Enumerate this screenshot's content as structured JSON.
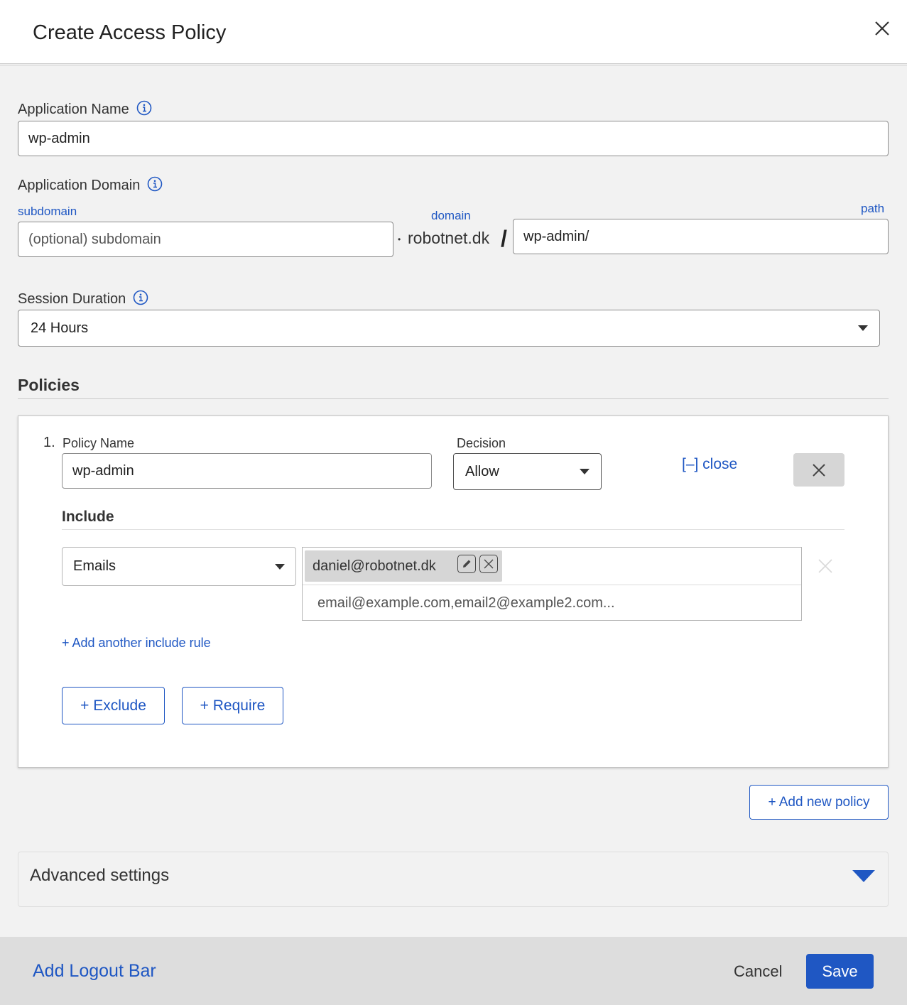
{
  "header": {
    "title": "Create Access Policy"
  },
  "app_name": {
    "label": "Application Name",
    "value": "wp-admin"
  },
  "app_domain": {
    "label": "Application Domain",
    "subdomain_label": "subdomain",
    "subdomain_placeholder": "(optional) subdomain",
    "domain_label": "domain",
    "dot": "•",
    "domain_value": "robotnet.dk",
    "slash": "/",
    "path_label": "path",
    "path_value": "wp-admin/"
  },
  "session": {
    "label": "Session Duration",
    "value": "24 Hours"
  },
  "policies": {
    "title": "Policies",
    "items": [
      {
        "number": "1.",
        "name_label": "Policy Name",
        "name_value": "wp-admin",
        "decision_label": "Decision",
        "decision_value": "Allow",
        "close_label": "[–] close",
        "include_title": "Include",
        "rule_type": "Emails",
        "email_tag": "daniel@robotnet.dk",
        "email_placeholder": "email@example.com,email2@example2.com...",
        "add_include_label": "+ Add another include rule",
        "exclude_label": "+ Exclude",
        "require_label": "+ Require"
      }
    ]
  },
  "add_policy_label": "+ Add new policy",
  "advanced": {
    "label": "Advanced settings"
  },
  "footer": {
    "logout_label": "Add Logout Bar",
    "cancel_label": "Cancel",
    "save_label": "Save"
  },
  "colors": {
    "accent": "#1f57c3",
    "save_bg": "#1f57c3",
    "footer_bg": "#dddddd"
  }
}
